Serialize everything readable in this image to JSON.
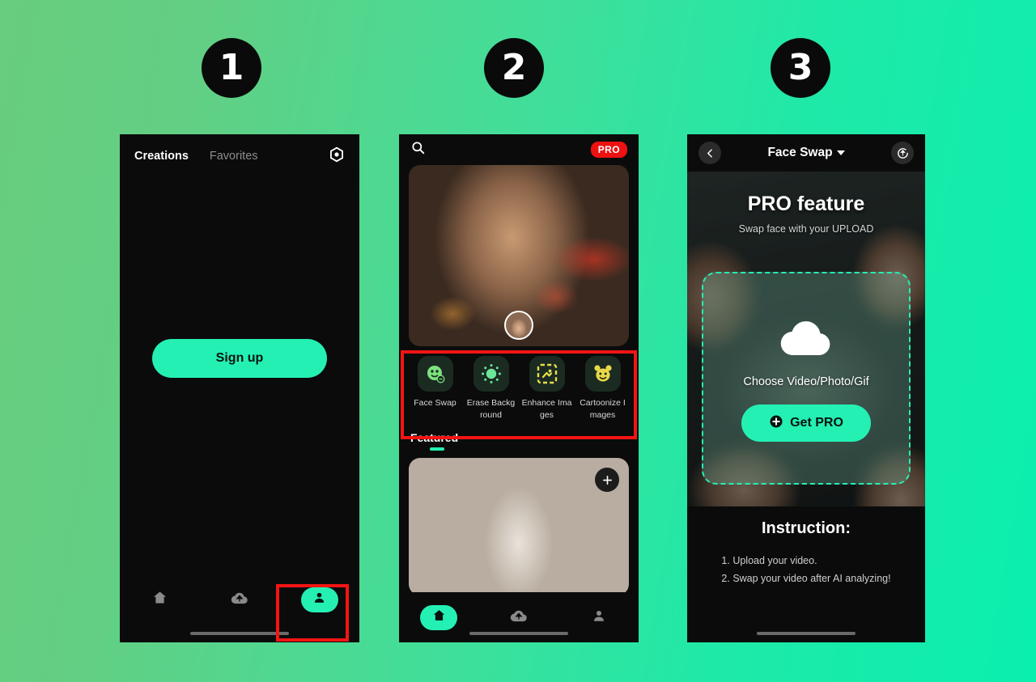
{
  "background": {
    "from": "#68cd7c",
    "to": "#0aefae"
  },
  "accent": "#24f0b4",
  "annotation_color": "#f41414",
  "steps": [
    {
      "number": "1"
    },
    {
      "number": "2"
    },
    {
      "number": "3"
    }
  ],
  "phone1": {
    "tabs": [
      {
        "label": "Creations",
        "active": true
      },
      {
        "label": "Favorites",
        "active": false
      }
    ],
    "settings_icon": "gear-icon",
    "signup_label": "Sign up",
    "nav": [
      {
        "icon": "home-icon",
        "label": "Home",
        "active": false
      },
      {
        "icon": "cloud-upload-icon",
        "label": "Upload",
        "active": false
      },
      {
        "icon": "profile-icon",
        "label": "Profile",
        "active": true
      }
    ]
  },
  "phone2": {
    "search_icon": "search-icon",
    "pro_badge": "PRO",
    "tools": [
      {
        "label": "Face Swap",
        "icon": "face-swap-icon"
      },
      {
        "label": "Erase Background",
        "icon": "erase-background-icon"
      },
      {
        "label": "Enhance Images",
        "icon": "enhance-images-icon"
      },
      {
        "label": "Cartoonize Images",
        "icon": "cartoonize-images-icon"
      }
    ],
    "featured_title": "Featured",
    "add_icon": "plus-icon",
    "nav": [
      {
        "icon": "home-icon",
        "label": "Home",
        "active": true
      },
      {
        "icon": "cloud-upload-icon",
        "label": "Upload",
        "active": false
      },
      {
        "icon": "profile-icon",
        "label": "Profile",
        "active": false
      }
    ]
  },
  "phone3": {
    "back_icon": "back-arrow-icon",
    "title": "Face Swap",
    "history_icon": "upload-history-icon",
    "hero_title": "PRO feature",
    "hero_subtitle": "Swap face with your UPLOAD",
    "upload_icon": "cloud-upload-icon",
    "choose_label": "Choose Video/Photo/Gif",
    "get_pro_label": "Get PRO",
    "get_pro_icon": "plus-circle-icon",
    "instruction_title": "Instruction:",
    "instructions": [
      "1. Upload your video.",
      "2. Swap your video after AI analyzing!"
    ]
  }
}
